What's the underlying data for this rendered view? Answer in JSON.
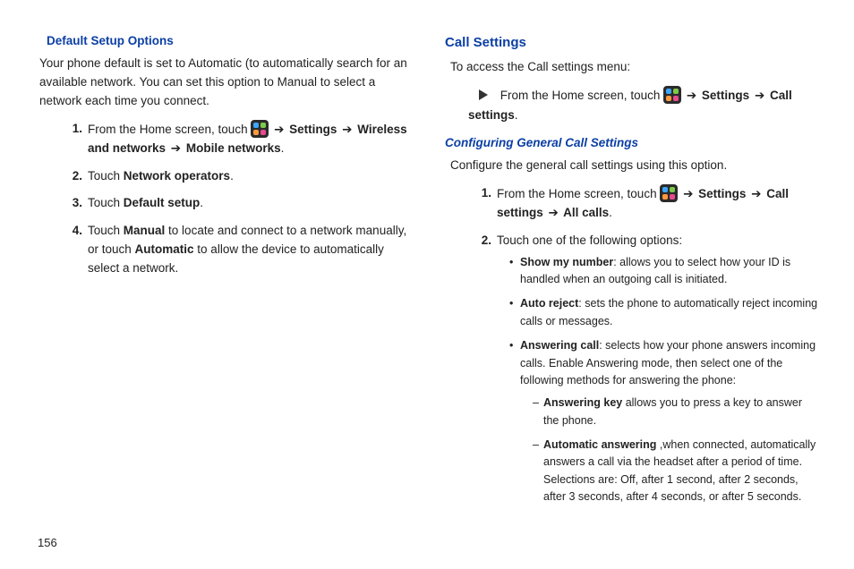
{
  "page_number": "156",
  "arrow": "➔",
  "left": {
    "heading": "Default Setup Options",
    "intro": "Your phone default is set to Automatic (to automatically search for an available network. You can set this option to Manual to select a network each time you connect.",
    "s1_num": "1.",
    "s1_a": "From the Home screen, touch ",
    "s1_b": " Settings ",
    "s1_c": " Wireless and networks ",
    "s1_d": " Mobile networks",
    "s2_num": "2.",
    "s2_a": "Touch ",
    "s2_b": "Network operators",
    "s3_num": "3.",
    "s3_a": "Touch ",
    "s3_b": "Default setup",
    "s4_num": "4.",
    "s4_a": "Touch ",
    "s4_b": "Manual",
    "s4_c": " to locate and connect to a network manually, or touch ",
    "s4_d": "Automatic",
    "s4_e": " to allow the device to automatically select a network."
  },
  "right": {
    "heading": "Call Settings",
    "intro": "To access the Call settings menu:",
    "p_a": "From the Home screen, touch ",
    "p_b": " Settings ",
    "p_c": " Call settings",
    "sub_heading": "Configuring General Call Settings",
    "sub_intro": "Configure the general call settings using this option.",
    "r1_num": "1.",
    "r1_a": "From the Home screen, touch ",
    "r1_b": " Settings ",
    "r1_c": " Call settings  ",
    "r1_d": " All calls",
    "r2_num": "2.",
    "r2_text": "Touch one of the following options:",
    "b1_t": "Show my number",
    "b1_d": ": allows you to select how your ID is handled when an outgoing call is initiated.",
    "b2_t": "Auto reject",
    "b2_d": ": sets the phone to automatically reject incoming calls or messages.",
    "b3_t": "Answering call",
    "b3_d": ": selects how your phone answers incoming calls. Enable Answering mode, then select one of the following methods for answering the phone:",
    "sl1_t": "Answering key",
    "sl1_d": " allows you to press a key to answer the phone.",
    "sl2_t": "Automatic answering",
    "sl2_d": " ,when connected, automatically answers a call via the headset after a period of time. Selections are: Off, after 1 second, after 2 seconds, after 3 seconds, after 4 seconds, or after 5 seconds."
  }
}
